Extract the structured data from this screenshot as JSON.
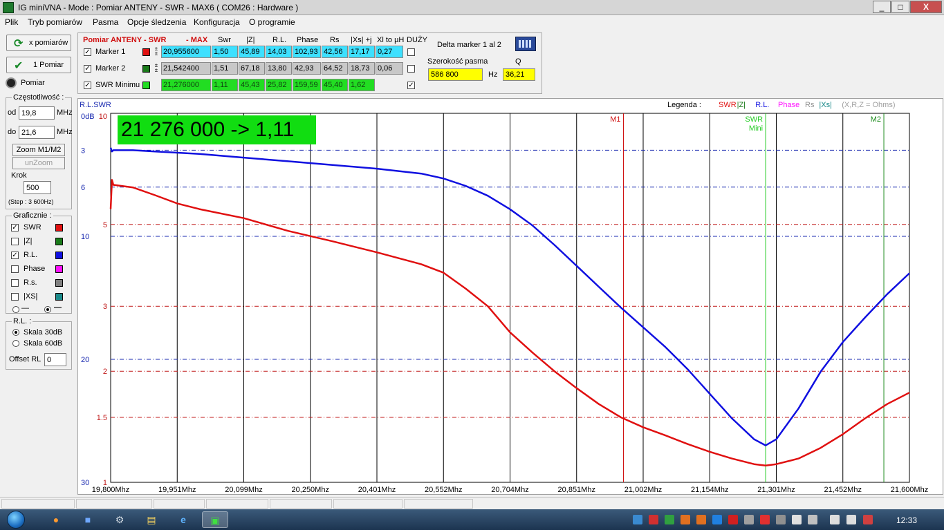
{
  "window": {
    "title": "IG miniVNA - Mode : Pomiar ANTENY - SWR    - MAX6 ( COM26 :  Hardware )",
    "controls": {
      "minimize": "_",
      "maximize": "□",
      "close": "X"
    }
  },
  "menu": [
    "Plik",
    "Tryb pomiarów",
    "Pasma",
    "Opcje śledzenia",
    "Konfiguracja",
    "O programie"
  ],
  "left_panel": {
    "x_measure_label": "x pomiarów",
    "one_measure_label": "1 Pomiar",
    "measure_indicator_label": "Pomiar",
    "frequency_group": "Częstotliwość :",
    "from_label": "od",
    "from_value": "19,8",
    "to_label": "do",
    "to_value": "21,6",
    "unit": "MHz",
    "zoom_button": "Zoom M1/M2",
    "unzoom_button": "unZoom",
    "step_label": "Krok",
    "step_value": "500",
    "step_note": "(Step : 3 600Hz)",
    "graphics_group": "Graficznie :",
    "graphics": [
      {
        "label": "SWR",
        "checked": true,
        "color": "#e01010"
      },
      {
        "label": "|Z|",
        "checked": false,
        "color": "#1a7a1a"
      },
      {
        "label": "R.L.",
        "checked": true,
        "color": "#1010e0"
      },
      {
        "label": "Phase",
        "checked": false,
        "color": "#ff10ff"
      },
      {
        "label": "R.s.",
        "checked": false,
        "color": "#808080"
      },
      {
        "label": "|XS|",
        "checked": false,
        "color": "#1a8a8a"
      }
    ],
    "line_style_a": "—",
    "line_style_b": "—",
    "rl_group": "R.L. :",
    "scale30": "Skala 30dB",
    "scale60": "Skala 60dB",
    "offset_label": "Offset RL",
    "offset_value": "0"
  },
  "marker_panel": {
    "title": "Pomiar ANTENY - SWR",
    "title_suffix": "- MAX",
    "headers": [
      "Swr",
      "|Z|",
      "R.L.",
      "Phase",
      "Rs",
      "|Xs| +j",
      "Xl to µH",
      "DUŻY"
    ],
    "rows": [
      {
        "label": "Marker 1",
        "color": "#e01010",
        "checked": true,
        "freq": "20,955600",
        "swr": "1,50",
        "z": "45,89",
        "rl": "14,03",
        "phase": "102,93",
        "rs": "42,56",
        "xs": "17,17",
        "xl": "0,27",
        "big": false
      },
      {
        "label": "Marker 2",
        "color": "#1a7a1a",
        "checked": true,
        "freq": "21,542400",
        "swr": "1,51",
        "z": "67,18",
        "rl": "13,80",
        "phase": "42,93",
        "rs": "64,52",
        "xs": "18,73",
        "xl": "0,06",
        "big": false
      },
      {
        "label": "SWR Minimu",
        "color": "#22dd22",
        "checked": true,
        "freq": "21,276000",
        "swr": "1,11",
        "z": "45,43",
        "rl": "25,82",
        "phase": "159,59",
        "rs": "45,40",
        "xs": "1,62",
        "xl": "",
        "big": true
      }
    ],
    "delta_label": "Delta marker 1 al 2",
    "bandwidth_label": "Szerokość pasma",
    "bandwidth_value": "586 800",
    "hz_label": "Hz",
    "q_label": "Q",
    "q_value": "36,21"
  },
  "chart_data": {
    "type": "line",
    "big_readout": "21 276 000 -> 1,11",
    "corner_label": "R.L.SWR",
    "legend_title": "Legenda :",
    "legend": [
      {
        "name": "SWR",
        "color": "#e01010"
      },
      {
        "name": "|Z|",
        "color": "#1a7a1a"
      },
      {
        "name": "R.L.",
        "color": "#1010e0"
      },
      {
        "name": "Phase",
        "color": "#ff10ff"
      },
      {
        "name": "Rs",
        "color": "#909090"
      },
      {
        "name": "|Xs|",
        "color": "#1a8a8a"
      },
      {
        "name": "(X,R,Z = Ohms)",
        "color": "#a0a0a0"
      }
    ],
    "xlim": [
      19.8,
      21.6
    ],
    "x_ticks": [
      "19,800Mhz",
      "19,951Mhz",
      "20,099Mhz",
      "20,250Mhz",
      "20,401Mhz",
      "20,552Mhz",
      "20,704Mhz",
      "20,851Mhz",
      "21,002Mhz",
      "21,154Mhz",
      "21,301Mhz",
      "21,452Mhz",
      "21,600Mhz"
    ],
    "rl_axis": {
      "ticks": [
        "0dB",
        "3",
        "6",
        "10",
        "20",
        "30"
      ],
      "values": [
        0,
        3,
        6,
        10,
        20,
        30
      ],
      "range": [
        0,
        30
      ]
    },
    "swr_axis": {
      "ticks": [
        "10",
        "5",
        "3",
        "2",
        "1.5",
        "1"
      ],
      "values": [
        10,
        5,
        3,
        2,
        1.5,
        1
      ],
      "scale": "log"
    },
    "markers": [
      {
        "label": "M1",
        "x": 20.9556,
        "color": "#d01010"
      },
      {
        "label": "SWR",
        "sublabel": "Mini",
        "x": 21.276,
        "color": "#22cc22"
      },
      {
        "label": "M2",
        "x": 21.5424,
        "color": "#1a8a1a"
      }
    ],
    "series": [
      {
        "name": "SWR",
        "color": "#e01010",
        "x": [
          19.8,
          19.803,
          19.806,
          19.85,
          19.9,
          19.95,
          20.0,
          20.1,
          20.2,
          20.3,
          20.4,
          20.5,
          20.55,
          20.6,
          20.65,
          20.7,
          20.75,
          20.8,
          20.85,
          20.9,
          20.95,
          21.0,
          21.05,
          21.1,
          21.15,
          21.2,
          21.25,
          21.276,
          21.3,
          21.35,
          21.4,
          21.45,
          21.5,
          21.55,
          21.6
        ],
        "values": [
          5.5,
          6.6,
          6.4,
          6.3,
          6.0,
          5.7,
          5.5,
          5.2,
          4.8,
          4.5,
          4.2,
          3.9,
          3.7,
          3.35,
          3.0,
          2.55,
          2.25,
          2.0,
          1.8,
          1.63,
          1.5,
          1.41,
          1.34,
          1.27,
          1.21,
          1.16,
          1.12,
          1.11,
          1.12,
          1.16,
          1.24,
          1.35,
          1.49,
          1.63,
          1.75
        ]
      },
      {
        "name": "R.L.",
        "color": "#1010e0",
        "x": [
          19.8,
          19.803,
          19.806,
          19.85,
          19.9,
          20.0,
          20.1,
          20.2,
          20.3,
          20.4,
          20.5,
          20.55,
          20.6,
          20.65,
          20.7,
          20.75,
          20.8,
          20.85,
          20.9,
          20.95,
          21.0,
          21.05,
          21.1,
          21.15,
          21.2,
          21.25,
          21.276,
          21.3,
          21.35,
          21.4,
          21.45,
          21.5,
          21.55,
          21.6
        ],
        "values": [
          2.8,
          3.1,
          3.0,
          3.0,
          3.1,
          3.3,
          3.6,
          3.9,
          4.2,
          4.5,
          4.9,
          5.3,
          5.9,
          6.7,
          7.8,
          9.1,
          10.7,
          12.4,
          14.1,
          15.8,
          17.4,
          19.0,
          20.8,
          22.8,
          24.8,
          26.5,
          27.0,
          26.5,
          24.0,
          21.0,
          18.6,
          16.6,
          14.7,
          13.0
        ]
      }
    ]
  },
  "status_bar": {
    "segments": 6
  },
  "taskbar": {
    "apps": [
      "firefox-icon",
      "disk-icon",
      "tools-icon",
      "explorer-icon",
      "ie-icon",
      "vna-icon"
    ],
    "clock": "12:33"
  }
}
